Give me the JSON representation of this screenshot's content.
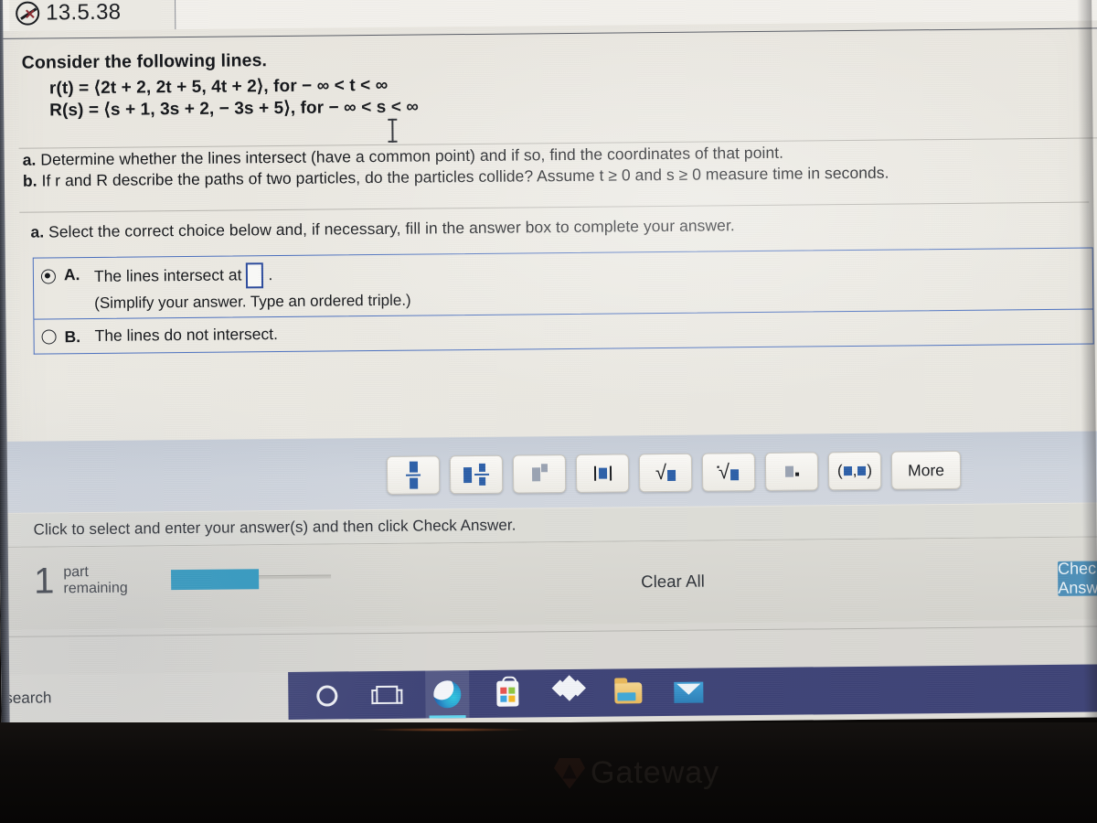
{
  "header": {
    "exercise_number": "13.5.38",
    "hide_icon": "hide-pen-icon"
  },
  "question": {
    "lead": "Consider the following lines.",
    "equation_r": "r(t) = ⟨2t + 2, 2t + 5, 4t + 2⟩, for − ∞ < t < ∞",
    "equation_R": "R(s) = ⟨s + 1, 3s + 2, − 3s + 5⟩, for − ∞ < s < ∞",
    "part_a_label": "a.",
    "part_a_text": "Determine whether the lines intersect (have a common point) and if so, find the coordinates of that point.",
    "part_b_label": "b.",
    "part_b_text": "If r and R describe the paths of two particles, do the particles collide? Assume t ≥ 0 and s ≥ 0 measure time in seconds.",
    "select_prompt_label": "a.",
    "select_prompt": "Select the correct choice below and, if necessary, fill in the answer box to complete your answer."
  },
  "choices": [
    {
      "letter": "A.",
      "text": "The lines intersect at",
      "trailing": ".",
      "hint": "(Simplify your answer. Type an ordered triple.)",
      "selected": true,
      "has_answer_box": true,
      "answer_value": ""
    },
    {
      "letter": "B.",
      "text": "The lines do not intersect.",
      "trailing": "",
      "hint": "",
      "selected": false,
      "has_answer_box": false,
      "answer_value": ""
    }
  ],
  "math_palette": {
    "buttons": [
      {
        "name": "fraction-button",
        "label": "■/■"
      },
      {
        "name": "mixed-number-button",
        "label": "■ ■/■"
      },
      {
        "name": "exponent-button",
        "label": "■▪"
      },
      {
        "name": "absolute-value-button",
        "label": "|■|"
      },
      {
        "name": "square-root-button",
        "label": "√■"
      },
      {
        "name": "nth-root-button",
        "label": "ⁿ√■"
      },
      {
        "name": "subscript-button",
        "label": "■."
      },
      {
        "name": "ordered-pair-button",
        "label": "(■,■)"
      }
    ],
    "more_label": "More"
  },
  "instruction": "Click to select and enter your answer(s) and then click Check Answer.",
  "footer": {
    "parts_number": "1",
    "parts_label_line1": "part",
    "parts_label_line2": "remaining",
    "progress_percent": 55,
    "clear_all_label": "Clear All",
    "check_answer_label": "Check Answer"
  },
  "taskbar": {
    "search_placeholder": "search",
    "items": [
      {
        "name": "cortana-icon",
        "label": "Cortana"
      },
      {
        "name": "task-view-icon",
        "label": "Task View"
      },
      {
        "name": "edge-browser-icon",
        "label": "Microsoft Edge"
      },
      {
        "name": "microsoft-store-icon",
        "label": "Microsoft Store"
      },
      {
        "name": "dropbox-icon",
        "label": "Dropbox"
      },
      {
        "name": "file-explorer-icon",
        "label": "File Explorer"
      },
      {
        "name": "mail-icon",
        "label": "Mail"
      }
    ]
  },
  "device": {
    "brand": "Gateway"
  },
  "colors": {
    "choice_border": "#4a6fbf",
    "answer_box_border": "#2b4a9c",
    "progress_fill": "#2f9ac2",
    "check_button": "#4d8fb8",
    "taskbar_bg": "#3d4276",
    "palette_glyph": "#2c5fa8"
  }
}
